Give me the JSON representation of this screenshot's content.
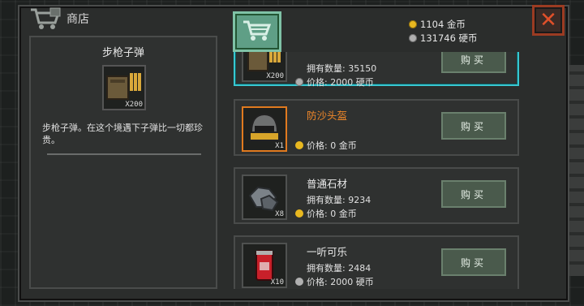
{
  "header": {
    "title": "商店"
  },
  "wallet": {
    "gold": "1104 金币",
    "silver": "131746 硬币"
  },
  "detail": {
    "name": "步枪子弹",
    "qty_label": "X200",
    "description": "步枪子弹。在这个境遇下子弹比一切都珍贵。"
  },
  "items": [
    {
      "name": "",
      "qty_label": "X200",
      "owned": "拥有数量: 35150",
      "price": "价格: 2000 硬币",
      "currency": "silver",
      "buy_label": "购买",
      "icon": "ammo-crate-icon"
    },
    {
      "name": "防沙头盔",
      "qty_label": "X1",
      "owned": "",
      "price": "价格: 0 金币",
      "currency": "gold",
      "buy_label": "购买",
      "icon": "helmet-icon"
    },
    {
      "name": "普通石材",
      "qty_label": "X8",
      "owned": "拥有数量: 9234",
      "price": "价格: 0 金币",
      "currency": "gold",
      "buy_label": "购买",
      "icon": "stone-icon"
    },
    {
      "name": "一听可乐",
      "qty_label": "X10",
      "owned": "拥有数量: 2484",
      "price": "价格: 2000 硬币",
      "currency": "silver",
      "buy_label": "购买",
      "icon": "cola-can-icon"
    }
  ],
  "colors": {
    "accent_cyan": "#38c7d1",
    "highlight_orange": "#f0882a",
    "close_red": "#e0502a",
    "tab_green": "#5f9f86"
  }
}
